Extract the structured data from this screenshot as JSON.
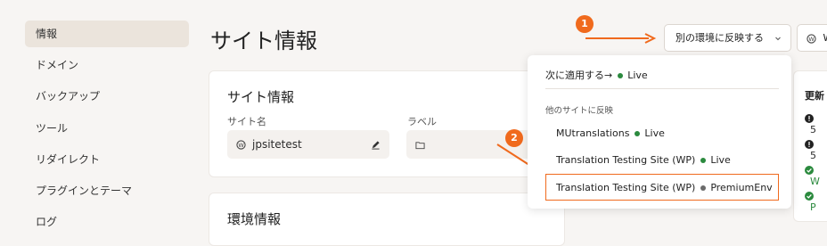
{
  "sidebar": {
    "items": [
      {
        "label": "情報",
        "active": true
      },
      {
        "label": "ドメイン"
      },
      {
        "label": "バックアップ"
      },
      {
        "label": "ツール"
      },
      {
        "label": "リダイレクト"
      },
      {
        "label": "プラグインとテーマ"
      },
      {
        "label": "ログ"
      }
    ]
  },
  "page": {
    "title": "サイト情報"
  },
  "site_info": {
    "title": "サイト情報",
    "site_name_label": "サイト名",
    "site_name_value": "jpsitetest",
    "label_label": "ラベル"
  },
  "env_card": {
    "title": "環境情報"
  },
  "header": {
    "reflect_button": "別の環境に反映する",
    "wp_button": "W"
  },
  "annotations": {
    "badge1": "1",
    "badge2": "2"
  },
  "dropdown": {
    "apply_next": "次に適用する→",
    "apply_next_status": "Live",
    "section_label": "他のサイトに反映",
    "items": [
      {
        "name": "MUtranslations",
        "env": "Live",
        "dot_color": "#2b8a3e"
      },
      {
        "name": "Translation Testing Site (WP)",
        "env": "Live",
        "dot_color": "#2b8a3e"
      },
      {
        "name": "Translation Testing Site (WP)",
        "env": "PremiumEnv",
        "dot_color": "#6b6b6b",
        "highlighted": true
      }
    ]
  },
  "updates": {
    "title": "更新",
    "rows": [
      {
        "icon": "error-icon",
        "text": "5"
      },
      {
        "icon": "error-icon",
        "text": "5"
      },
      {
        "icon": "check-icon",
        "text": "W"
      },
      {
        "icon": "check-icon",
        "text": "P"
      }
    ]
  },
  "colors": {
    "accent": "#f06a1d",
    "live": "#2b8a3e",
    "sidebar_active": "#ebe4dc"
  }
}
